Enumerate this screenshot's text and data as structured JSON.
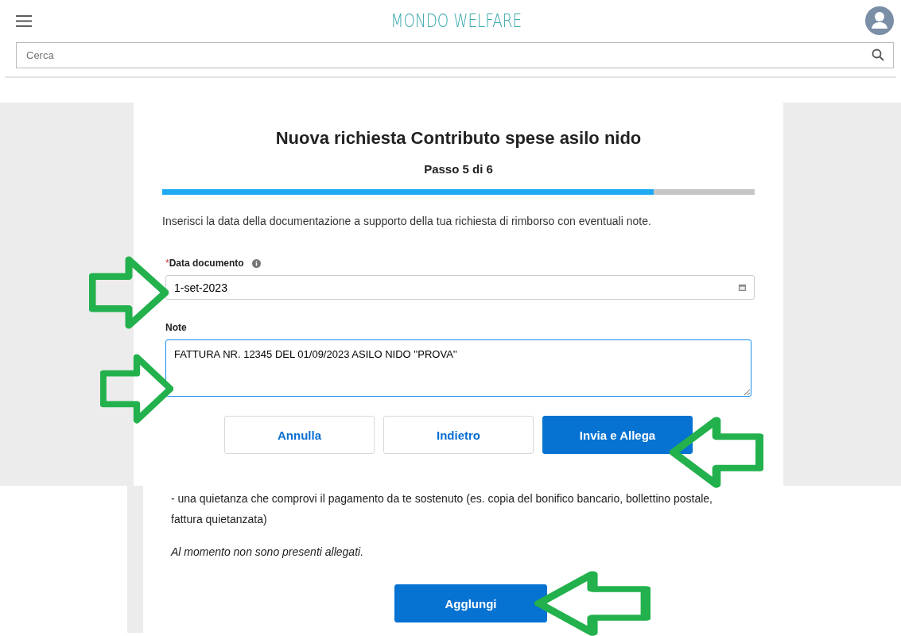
{
  "header": {
    "logo": "MONDO WELFARE",
    "search": {
      "placeholder": "Cerca"
    }
  },
  "form": {
    "title": "Nuova richiesta Contributo spese asilo nido",
    "step": "Passo 5 di 6",
    "progress": {
      "level": 0.83
    },
    "intro": "Inserisci la data della documentazione a supporto della tua richiesta di rimborso con eventuali note.",
    "fields": [
      {
        "kind": "date",
        "required_mark": "*",
        "label": "Data documento",
        "value": "1-set-2023"
      },
      {
        "kind": "textarea",
        "label": "Note",
        "value": "FATTURA NR. 12345 DEL 01/09/2023 ASILO NIDO ''PROVA''"
      }
    ],
    "buttons": [
      {
        "label": "Annulla",
        "primary": false
      },
      {
        "label": "Indietro",
        "primary": false
      },
      {
        "label": "Invia e Allega",
        "primary": true
      }
    ]
  },
  "attachments": {
    "requirement": "- una quietanza che comprovi il pagamento da te sostenuto (es. copia del bonifico bancario, bollettino postale, fattura quietanzata)",
    "empty_note": "Al momento non sono presenti allegati.",
    "add_button": "Agglungi"
  },
  "annotations": [
    {
      "kind": "rightward"
    },
    {
      "kind": "rightward"
    },
    {
      "kind": "leftward"
    },
    {
      "kind": "leftward"
    }
  ]
}
